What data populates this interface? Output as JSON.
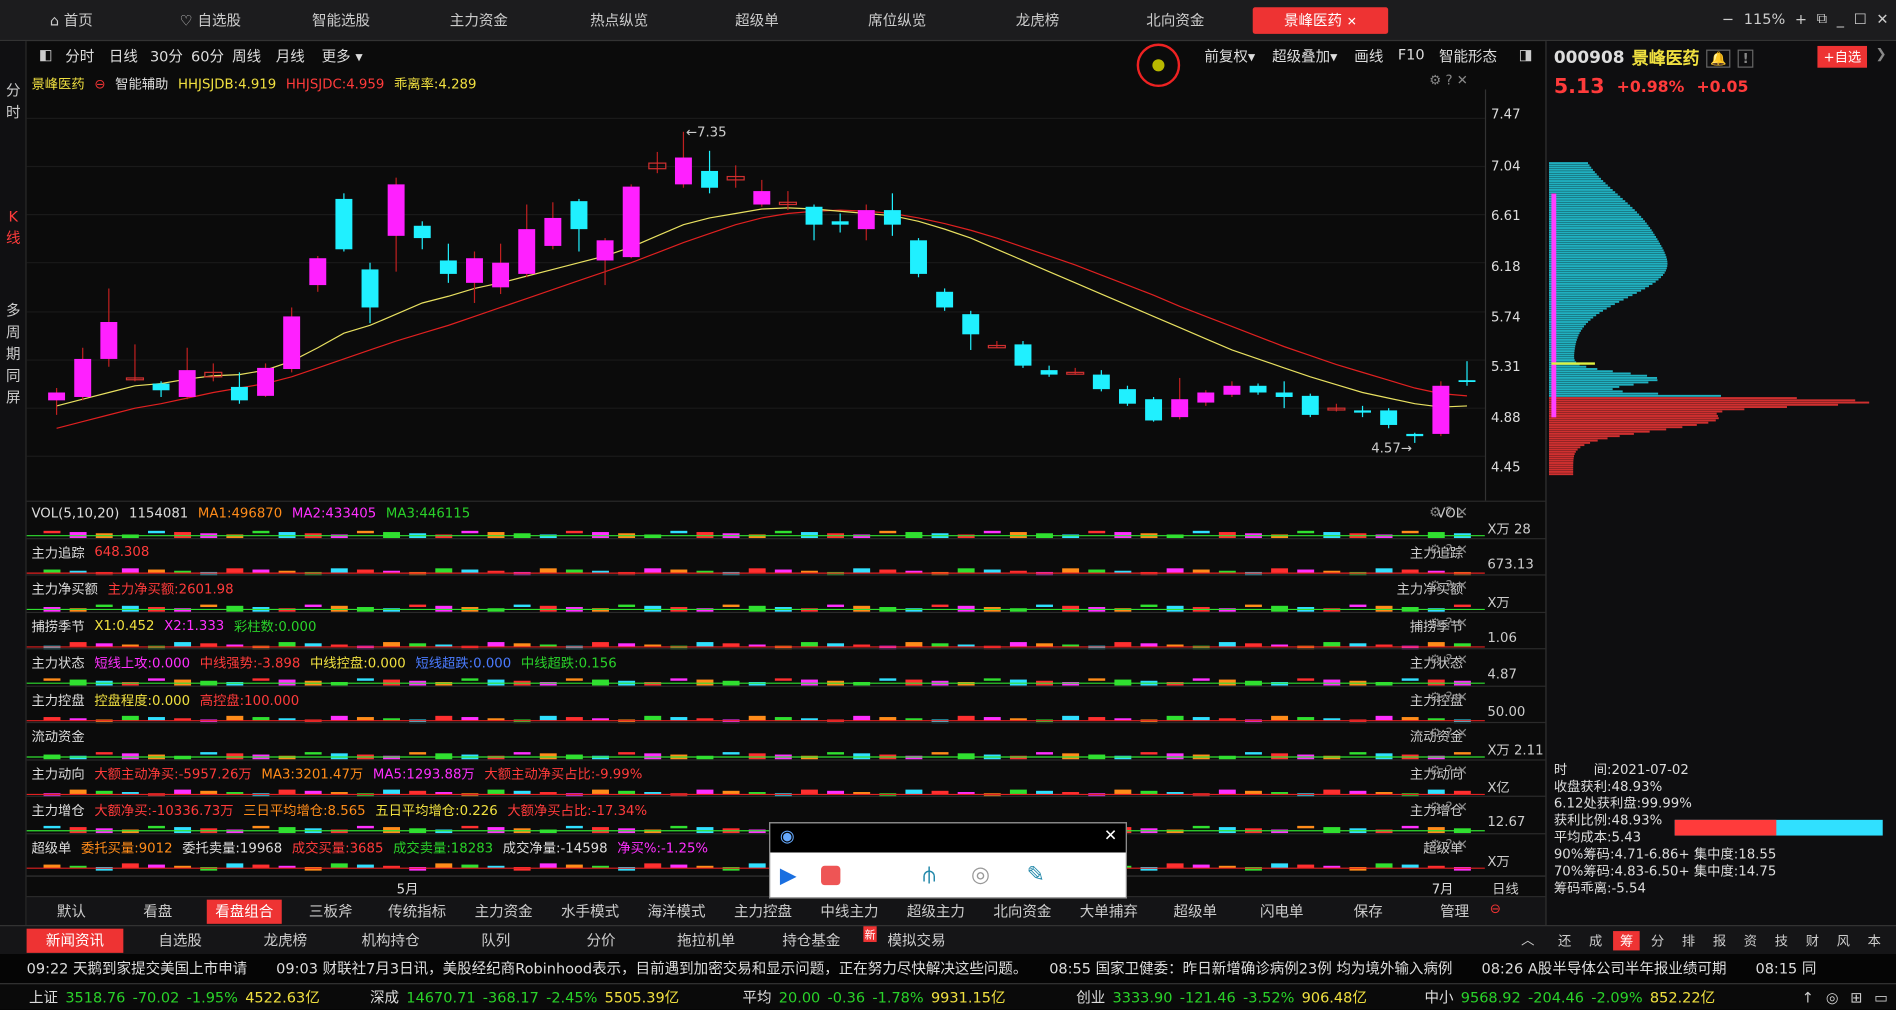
{
  "topnav": {
    "tabs": [
      "首页",
      "自选股",
      "智能选股",
      "主力资金",
      "热点纵览",
      "超级单",
      "席位纵览",
      "龙虎榜",
      "北向资金",
      "景峰医药"
    ],
    "zoom": "115%"
  },
  "lefttabs": [
    "分时",
    "K线",
    "多周期同屏"
  ],
  "periods": {
    "items": [
      "分时",
      "日线",
      "30分",
      "60分",
      "周线",
      "月线",
      "更多"
    ],
    "right": [
      "前复权",
      "超级叠加",
      "画线",
      "F10",
      "智能形态"
    ]
  },
  "kline": {
    "stock": "景峰医药",
    "assist": "智能辅助",
    "ind1": "HHJSJDB:4.919",
    "ind2": "HHJSJDC:4.959",
    "ind3": "乖离率:4.289",
    "high_mark": "7.35",
    "low_mark": "4.57",
    "month_may": "5月",
    "month_jul": "7月",
    "axis": [
      "7.47",
      "7.04",
      "6.61",
      "6.18",
      "5.74",
      "5.31",
      "4.88",
      "4.45"
    ]
  },
  "panes": [
    {
      "id": "vol",
      "left": [
        [
          "VOL(5,10,20)",
          "w"
        ],
        [
          "1154081",
          "w"
        ],
        [
          "MA1:496870",
          "o"
        ],
        [
          "MA2:433405",
          "m"
        ],
        [
          "MA3:446115",
          "g"
        ]
      ],
      "right": "VOL",
      "axis": "X万 28"
    },
    {
      "id": "zlzz",
      "left": [
        [
          "主力追踪",
          "w"
        ],
        [
          "648.308",
          "r"
        ]
      ],
      "right": "主力追踪",
      "axis": "673.13"
    },
    {
      "id": "zljme",
      "left": [
        [
          "主力净买额",
          "w"
        ],
        [
          "主力净买额:2601.98",
          "r"
        ]
      ],
      "right": "主力净买额",
      "axis": "X万"
    },
    {
      "id": "blj",
      "left": [
        [
          "捕捞季节",
          "w"
        ],
        [
          "X1:0.452",
          "y"
        ],
        [
          "X2:1.333",
          "m"
        ],
        [
          "彩柱数:0.000",
          "g"
        ]
      ],
      "right": "捕捞季节",
      "axis": "1.06"
    },
    {
      "id": "zlzt",
      "left": [
        [
          "主力状态",
          "w"
        ],
        [
          "短线上攻:0.000",
          "m"
        ],
        [
          "中线强势:-3.898",
          "r"
        ],
        [
          "中线控盘:0.000",
          "y"
        ],
        [
          "短线超跌:0.000",
          "b"
        ],
        [
          "中线超跌:0.156",
          "g"
        ]
      ],
      "right": "主力状态",
      "axis": "4.87"
    },
    {
      "id": "zlkp",
      "left": [
        [
          "主力控盘",
          "w"
        ],
        [
          "控盘程度:0.000",
          "y"
        ],
        [
          "高控盘:100.000",
          "r"
        ]
      ],
      "right": "主力控盘",
      "axis": "50.00"
    },
    {
      "id": "ldzj",
      "left": [
        [
          "流动资金",
          "w"
        ]
      ],
      "right": "流动资金",
      "axis": "X万 2.11"
    },
    {
      "id": "zldx",
      "left": [
        [
          "主力动向",
          "w"
        ],
        [
          "大额主动净买:-5957.26万",
          "r"
        ],
        [
          "MA3:3201.47万",
          "o"
        ],
        [
          "MA5:1293.88万",
          "m"
        ],
        [
          "大额主动净买占比:-9.99%",
          "r"
        ]
      ],
      "right": "主力动向",
      "axis": "X亿"
    },
    {
      "id": "zlzc",
      "left": [
        [
          "主力增仓",
          "w"
        ],
        [
          "大额净买:-10336.73万",
          "r"
        ],
        [
          "三日平均增仓:8.565",
          "o"
        ],
        [
          "五日平均增仓:0.226",
          "y"
        ],
        [
          "大额净买占比:-17.34%",
          "r"
        ]
      ],
      "right": "主力增仓",
      "axis": "12.67"
    },
    {
      "id": "cjd",
      "left": [
        [
          "超级单",
          "w"
        ],
        [
          "委托买量:9012",
          "o"
        ],
        [
          "委托卖量:19968",
          "w"
        ],
        [
          "成交买量:3685",
          "r"
        ],
        [
          "成交卖量:18283",
          "g"
        ],
        [
          "成交净量:-14598",
          "w"
        ],
        [
          "净买%:-1.25%",
          "m"
        ]
      ],
      "right": "超级单",
      "axis": "X万"
    }
  ],
  "bottomtabs": [
    "默认",
    "看盘",
    "看盘组合",
    "三板斧",
    "传统指标",
    "主力资金",
    "水手模式",
    "海洋模式",
    "主力控盘",
    "中线主力",
    "超级主力",
    "北向资金",
    "大单捕弃",
    "超级单",
    "闪电单",
    "保存",
    "管理"
  ],
  "bottom_period": "日线",
  "right": {
    "code": "000908",
    "name": "景峰医药",
    "add": "+自选",
    "price": "5.13",
    "pct": "+0.98%",
    "chg": "+0.05",
    "chip": [
      [
        "时　　间:2021-07-02",
        "w"
      ],
      [
        "收盘获利:48.93%",
        "w"
      ],
      [
        "6.12处获利盘:99.99%",
        "w"
      ],
      [
        "获利比例:48.93%",
        "w"
      ],
      [
        "平均成本:5.43",
        "w"
      ],
      [
        "90%筹码:4.71-6.86+ 集中度:18.55",
        "w"
      ],
      [
        "70%筹码:4.83-6.50+ 集中度:14.75",
        "w"
      ],
      [
        "筹码乖离:-5.54",
        "w"
      ]
    ],
    "profit_ratio": 0.4893
  },
  "newsbar": {
    "items": [
      "新闻资讯",
      "自选股",
      "龙虎榜",
      "机构持仓",
      "队列",
      "分价",
      "拖拉机单",
      "持仓基金",
      "模拟交易"
    ],
    "new_badge": "新",
    "right": [
      "还",
      "成",
      "筹",
      "分",
      "排",
      "报",
      "资",
      "技",
      "财",
      "风",
      "本"
    ]
  },
  "ticker": "09:22 天鹅到家提交美国上市申请　　09:03 财联社7月3日讯，美股经纪商Robinhood表示，目前遇到加密交易和显示问题，正在努力尽快解决这些问题。　　08:55 国家卫健委：昨日新增确诊病例23例 均为境外输入病例　　08:26 A股半导体公司半年报业绩可期　　08:15 同",
  "indexbar": [
    {
      "name": "上证",
      "v": "3518.76",
      "c": "-70.02",
      "p": "-1.95%",
      "a": "4522.63亿"
    },
    {
      "name": "深成",
      "v": "14670.71",
      "c": "-368.17",
      "p": "-2.45%",
      "a": "5505.39亿"
    },
    {
      "name": "平均",
      "v": "20.00",
      "c": "-0.36",
      "p": "-1.78%",
      "a": "9931.15亿"
    },
    {
      "name": "创业",
      "v": "3333.90",
      "c": "-121.46",
      "p": "-3.52%",
      "a": "906.48亿"
    },
    {
      "name": "中小",
      "v": "9568.92",
      "c": "-204.46",
      "p": "-2.09%",
      "a": "852.22亿"
    }
  ],
  "chart_data": {
    "type": "candlestick",
    "series": [
      [
        4.95,
        5.02,
        4.82,
        5.06
      ],
      [
        4.98,
        5.32,
        4.95,
        5.42
      ],
      [
        5.32,
        5.65,
        5.25,
        5.95
      ],
      [
        5.14,
        5.15,
        5.12,
        5.45
      ],
      [
        5.1,
        5.04,
        4.98,
        5.12
      ],
      [
        4.98,
        5.22,
        4.96,
        5.42
      ],
      [
        5.16,
        5.2,
        5.12,
        5.28
      ],
      [
        5.07,
        4.95,
        4.92,
        5.2
      ],
      [
        4.99,
        5.24,
        4.98,
        5.28
      ],
      [
        5.23,
        5.7,
        5.2,
        5.78
      ],
      [
        5.98,
        6.22,
        5.92,
        6.24
      ],
      [
        6.75,
        6.3,
        6.28,
        6.8
      ],
      [
        6.12,
        5.78,
        5.64,
        6.18
      ],
      [
        6.42,
        6.88,
        6.1,
        6.94
      ],
      [
        6.51,
        6.4,
        6.3,
        6.55
      ],
      [
        6.2,
        6.08,
        6.0,
        6.35
      ],
      [
        6.0,
        6.22,
        5.82,
        6.28
      ],
      [
        5.96,
        6.18,
        5.9,
        6.35
      ],
      [
        6.08,
        6.48,
        6.05,
        6.7
      ],
      [
        6.33,
        6.58,
        6.3,
        6.72
      ],
      [
        6.73,
        6.48,
        6.28,
        6.75
      ],
      [
        6.2,
        6.38,
        5.98,
        6.4
      ],
      [
        6.23,
        6.86,
        6.22,
        6.88
      ],
      [
        7.02,
        7.07,
        6.98,
        7.17
      ],
      [
        6.88,
        7.12,
        6.85,
        7.35
      ],
      [
        7.0,
        6.85,
        6.8,
        7.18
      ],
      [
        6.92,
        6.95,
        6.85,
        7.05
      ],
      [
        6.7,
        6.82,
        6.68,
        6.92
      ],
      [
        6.7,
        6.72,
        6.65,
        6.82
      ],
      [
        6.68,
        6.52,
        6.38,
        6.7
      ],
      [
        6.55,
        6.52,
        6.45,
        6.62
      ],
      [
        6.48,
        6.65,
        6.38,
        6.7
      ],
      [
        6.65,
        6.52,
        6.42,
        6.8
      ],
      [
        6.38,
        6.08,
        6.05,
        6.4
      ],
      [
        5.92,
        5.78,
        5.75,
        5.95
      ],
      [
        5.72,
        5.54,
        5.4,
        5.75
      ],
      [
        5.42,
        5.44,
        5.42,
        5.48
      ],
      [
        5.45,
        5.26,
        5.24,
        5.48
      ],
      [
        5.22,
        5.18,
        5.16,
        5.26
      ],
      [
        5.2,
        5.2,
        5.18,
        5.24
      ],
      [
        5.18,
        5.05,
        5.03,
        5.22
      ],
      [
        5.05,
        4.92,
        4.9,
        5.08
      ],
      [
        4.96,
        4.77,
        4.76,
        4.98
      ],
      [
        4.8,
        4.96,
        4.78,
        5.15
      ],
      [
        4.93,
        5.02,
        4.9,
        5.04
      ],
      [
        5.0,
        5.08,
        4.98,
        5.12
      ],
      [
        5.08,
        5.02,
        5.0,
        5.1
      ],
      [
        5.02,
        4.98,
        4.88,
        5.12
      ],
      [
        4.99,
        4.82,
        4.8,
        5.01
      ],
      [
        4.87,
        4.88,
        4.85,
        4.92
      ],
      [
        4.86,
        4.84,
        4.8,
        4.9
      ],
      [
        4.86,
        4.73,
        4.7,
        4.88
      ],
      [
        4.65,
        4.63,
        4.57,
        4.66
      ],
      [
        4.65,
        5.08,
        4.63,
        5.12
      ],
      [
        5.13,
        5.12,
        5.08,
        5.3
      ]
    ],
    "axis": {
      "y": [
        7.47,
        7.04,
        6.61,
        6.18,
        5.74,
        5.31,
        4.88,
        4.45
      ],
      "ymin": 4.27,
      "ymax": 7.62
    },
    "ma1": [
      4.9,
      4.96,
      5.02,
      5.08,
      5.1,
      5.14,
      5.17,
      5.18,
      5.22,
      5.3,
      5.42,
      5.55,
      5.62,
      5.72,
      5.82,
      5.88,
      5.95,
      6.0,
      6.06,
      6.12,
      6.18,
      6.24,
      6.32,
      6.42,
      6.52,
      6.58,
      6.62,
      6.66,
      6.67,
      6.66,
      6.64,
      6.62,
      6.6,
      6.55,
      6.48,
      6.4,
      6.3,
      6.2,
      6.1,
      6.0,
      5.9,
      5.8,
      5.7,
      5.6,
      5.5,
      5.4,
      5.32,
      5.24,
      5.16,
      5.09,
      5.02,
      4.97,
      4.92,
      4.89,
      4.9
    ],
    "ma2": [
      4.7,
      4.76,
      4.82,
      4.88,
      4.92,
      4.97,
      5.02,
      5.06,
      5.1,
      5.16,
      5.24,
      5.32,
      5.4,
      5.48,
      5.55,
      5.62,
      5.7,
      5.78,
      5.86,
      5.94,
      6.02,
      6.1,
      6.18,
      6.27,
      6.36,
      6.44,
      6.52,
      6.58,
      6.62,
      6.64,
      6.65,
      6.64,
      6.62,
      6.58,
      6.53,
      6.47,
      6.4,
      6.32,
      6.24,
      6.16,
      6.07,
      5.98,
      5.89,
      5.79,
      5.7,
      5.61,
      5.52,
      5.43,
      5.35,
      5.27,
      5.2,
      5.13,
      5.06,
      5.01,
      4.99
    ]
  }
}
